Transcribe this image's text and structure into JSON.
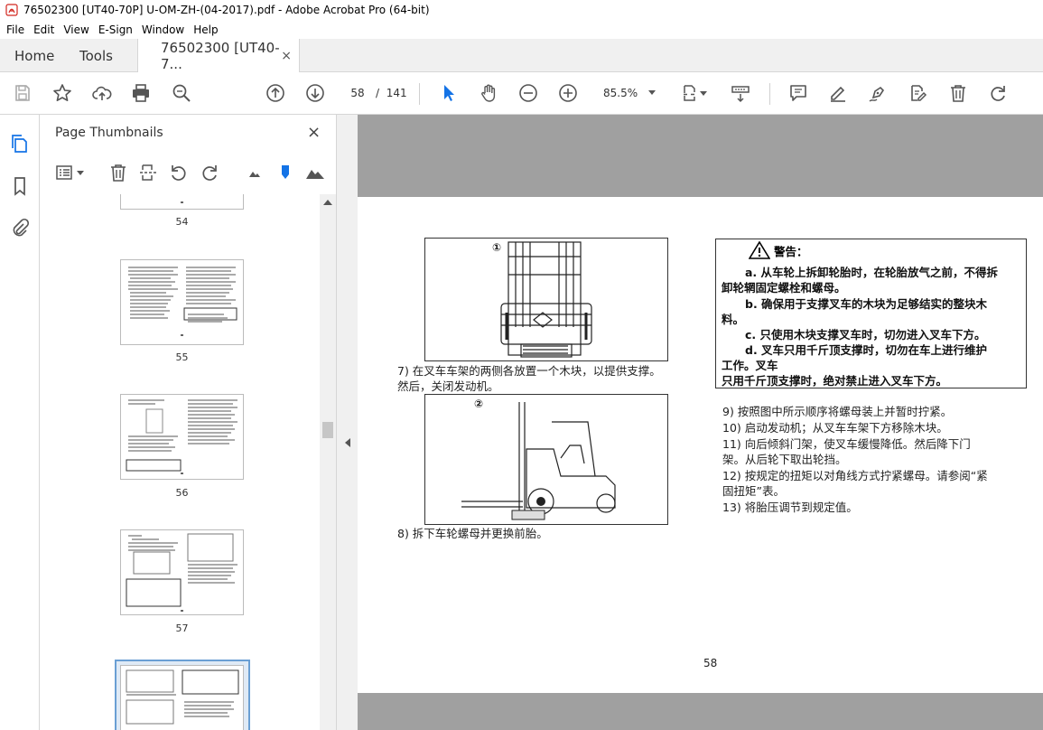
{
  "window": {
    "title": "76502300 [UT40-70P] U-OM-ZH-(04-2017).pdf - Adobe Acrobat Pro (64-bit)"
  },
  "menu": [
    "File",
    "Edit",
    "View",
    "E-Sign",
    "Window",
    "Help"
  ],
  "tabs": {
    "home": "Home",
    "tools": "Tools",
    "doc": "76502300 [UT40-7...",
    "close": "×"
  },
  "toolbar": {
    "page_current": "58",
    "page_sep": "/",
    "page_total": "141",
    "zoom": "85.5%"
  },
  "panel": {
    "title": "Page Thumbnails",
    "close": "×"
  },
  "thumbnails": [
    "54",
    "55",
    "56",
    "57"
  ],
  "document": {
    "fig1_label": "①",
    "fig2_label": "②",
    "step7_line1": "7)  在叉车车架的两侧各放置一个木块，以提供支撑。",
    "step7_line2": "然后，关闭发动机。",
    "step8": "8)  拆下车轮螺母并更换前胎。",
    "warning_title": "警告：",
    "warning_lines": [
      "a.  从车轮上拆卸轮胎时，在轮胎放气之前，不得拆",
      "卸轮辋固定螺栓和螺母。",
      "b.  确保用于支撑叉车的木块为足够结实的整块木",
      "料。",
      "c.  只使用木块支撑叉车时，切勿进入叉车下方。",
      "d.  叉车只用千斤顶支撑时，切勿在车上进行维护",
      "工作。叉车",
      "只用千斤顶支撑时，绝对禁止进入叉车下方。"
    ],
    "step9": "9)  按照图中所示顺序将螺母装上并暂时拧紧。",
    "step10": "10)  启动发动机；从叉车车架下方移除木块。",
    "step11_line1": "11)  向后倾斜门架，使叉车缓慢降低。然后降下门",
    "step11_line2": "架。从后轮下取出轮挡。",
    "step12_line1": "12)  按规定的扭矩以对角线方式拧紧螺母。请参阅“紧",
    "step12_line2": "固扭矩”表。",
    "step13": "13)  将胎压调节到规定值。",
    "page_number": "58"
  },
  "colors": {
    "accent": "#1473e6",
    "viewer_bg": "#a0a0a0",
    "icon": "#555555"
  }
}
